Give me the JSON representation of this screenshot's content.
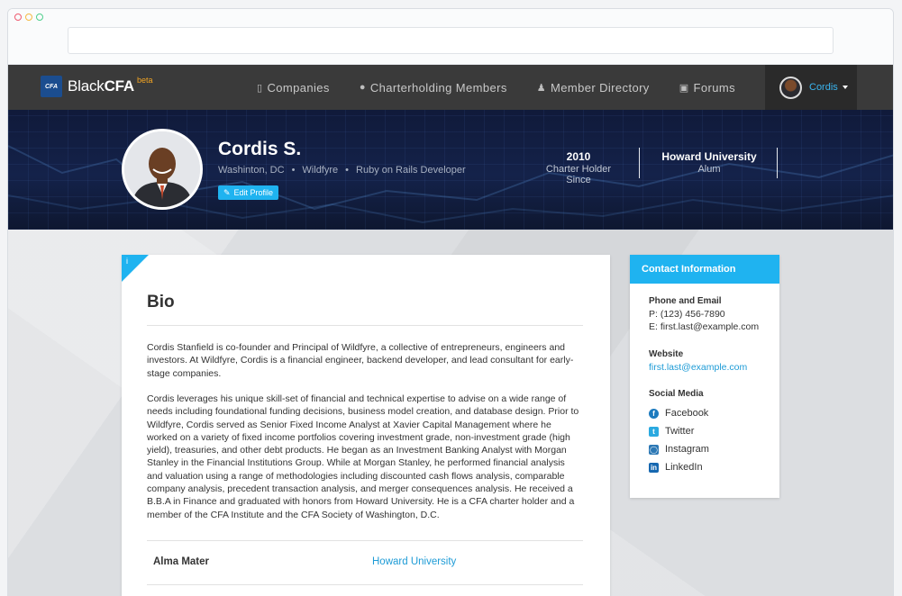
{
  "nav": {
    "brand_logo": "CFA",
    "brand_name_prefix": "Black",
    "brand_name_bold": "CFA",
    "brand_beta": "beta",
    "links": [
      {
        "label": "Companies",
        "icon": "building-icon"
      },
      {
        "label": "Charterholding Members",
        "icon": "circle-icon"
      },
      {
        "label": "Member Directory",
        "icon": "users-icon"
      },
      {
        "label": "Forums",
        "icon": "chat-icon"
      }
    ],
    "user_name": "Cordis"
  },
  "profile": {
    "name": "Cordis S.",
    "location": "Washinton, DC",
    "company": "Wildfyre",
    "title": "Ruby on Rails Developer",
    "edit_label": "Edit Profile",
    "stats": [
      {
        "value": "2010",
        "label": "Charter Holder Since"
      },
      {
        "value": "Howard University",
        "label": "Alum"
      }
    ]
  },
  "bio": {
    "title": "Bio",
    "paragraphs": [
      "Cordis Stanfield is co-founder and Principal of Wildfyre, a collective of entrepreneurs, engineers and investors. At Wildfyre, Cordis is a financial engineer, backend developer, and lead consultant for early-stage companies.",
      "Cordis leverages his unique skill-set of financial and technical expertise to advise on a wide range of needs including foundational funding decisions, business model creation, and database design. Prior to Wildfyre, Cordis served as Senior Fixed Income Analyst at Xavier Capital Management where he worked on a variety of fixed income portfolios covering investment grade, non-investment grade (high yield), treasuries, and other debt products. He began as an Investment Banking Analyst with Morgan Stanley in the Financial Institutions Group. While at Morgan Stanley, he performed financial analysis and valuation using a range of methodologies including discounted cash flows analysis, comparable company analysis, precedent transaction analysis, and merger consequences analysis. He received a B.B.A in Finance and graduated with honors from Howard University. He is a CFA charter holder and a member of the CFA Institute and the CFA Society of Washington, D.C."
    ],
    "alma_label": "Alma Mater",
    "alma_value": "Howard University"
  },
  "contact": {
    "header": "Contact Information",
    "phone_email_title": "Phone and Email",
    "phone": "P: (123) 456-7890",
    "email": "E: first.last@example.com",
    "website_title": "Website",
    "website": "first.last@example.com",
    "social_title": "Social Media",
    "social": [
      {
        "label": "Facebook",
        "icon": "facebook-icon"
      },
      {
        "label": "Twitter",
        "icon": "twitter-icon"
      },
      {
        "label": "Instagram",
        "icon": "instagram-icon"
      },
      {
        "label": "LinkedIn",
        "icon": "linkedin-icon"
      }
    ]
  },
  "colors": {
    "accent": "#1fb3f0",
    "navbar": "#3a3a3a",
    "link": "#1d9bd6",
    "beta": "#f5a623"
  }
}
